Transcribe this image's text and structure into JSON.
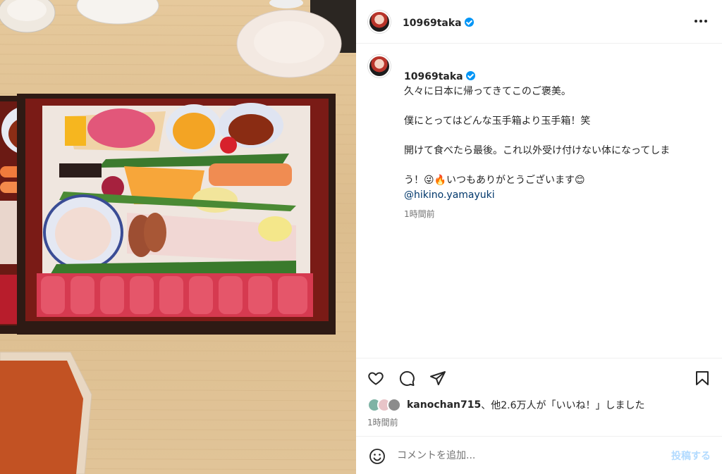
{
  "post": {
    "username": "10969taka",
    "verified": true,
    "caption_lines": [
      "久々に日本に帰ってきてこのご褒美。",
      "僕にとってはどんな玉手箱より玉手箱！笑",
      "開けて食べたら最後。これ以外受け付けない体になってしま",
      "う！😜🔥いつもありがとうございます😊"
    ],
    "mention": "@hikino.yamayuki",
    "caption_time": "1時間前",
    "likes_user": "kanochan715",
    "likes_text": "、他2.6万人が「いいね！」しました",
    "post_time": "1時間前"
  },
  "comment": {
    "placeholder": "コメントを追加...",
    "post_label": "投稿する"
  },
  "icons": {
    "more": "more-horizontal-icon",
    "like": "heart-icon",
    "comment": "comment-icon",
    "share": "send-icon",
    "save": "bookmark-icon",
    "emoji": "emoji-icon"
  },
  "colors": {
    "verified": "#0095f6",
    "link": "#00376b",
    "post_button_disabled": "#b3dbff",
    "muted_text": "#737373"
  }
}
